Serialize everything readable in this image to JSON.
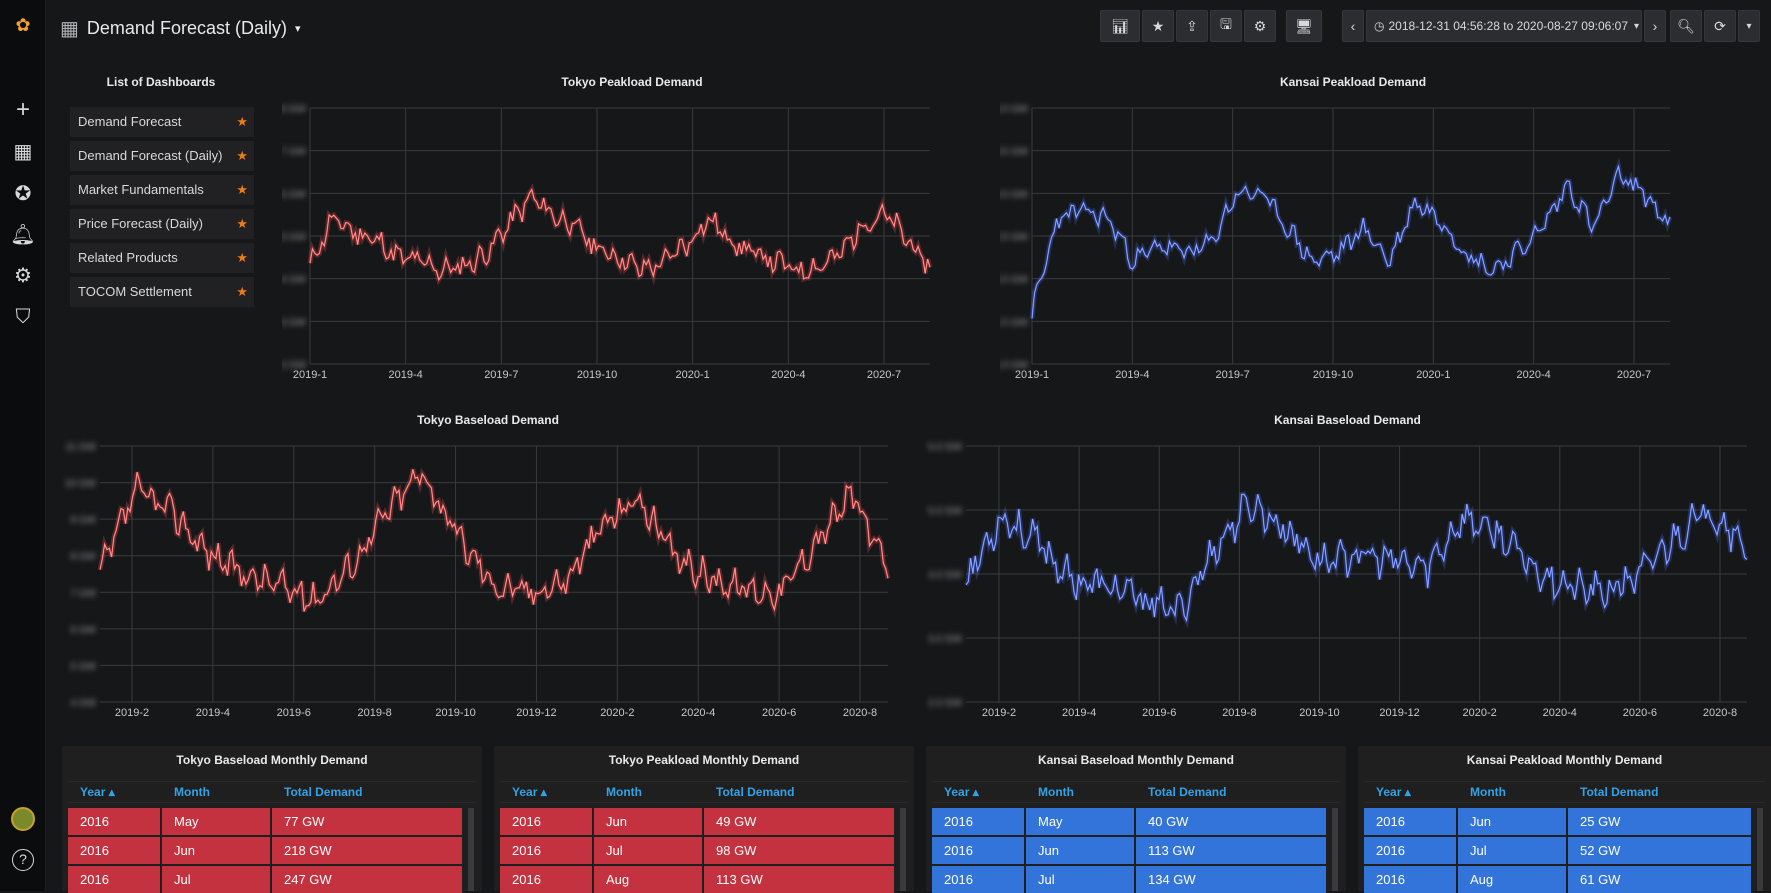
{
  "topbar": {
    "title": "Demand Forecast (Daily)",
    "time_range": "2018-12-31 04:56:28 to 2020-08-27 09:06:07"
  },
  "icons": {
    "logo": "grafana-logo",
    "add": "plus-icon",
    "dashboards": "grid-icon",
    "explore": "compass-icon",
    "alerting": "bell-icon",
    "config": "gear-icon",
    "admin": "shield-icon",
    "help": "help-icon"
  },
  "dashlist": {
    "title": "List of Dashboards",
    "items": [
      {
        "label": "Demand Forecast"
      },
      {
        "label": "Demand Forecast (Daily)"
      },
      {
        "label": "Market Fundamentals"
      },
      {
        "label": "Price Forecast (Daily)"
      },
      {
        "label": "Related Products"
      },
      {
        "label": "TOCOM Settlement"
      }
    ]
  },
  "colors": {
    "red": "#e02f44",
    "red_cell": "#c4313f",
    "blue": "#5577ff",
    "blue_cell": "#3274d9",
    "bg": "#161719"
  },
  "chart_data": [
    {
      "type": "line",
      "title": "Tokyo Peakload Demand",
      "color": "#ff5a5a",
      "x": [
        "2019-1",
        "2019-4",
        "2019-7",
        "2019-10",
        "2020-1",
        "2020-4",
        "2020-7"
      ],
      "yticks": [
        "8 GW",
        "7 GW",
        "6 GW",
        "5 GW",
        "4 GW",
        "3 GW",
        "2 GW"
      ],
      "series": [
        {
          "values": [
            4.3,
            5.4,
            5.1,
            4.9,
            4.5,
            4.4,
            4.2,
            4.3,
            4.6,
            5.3,
            5.9,
            5.5,
            5.2,
            4.7,
            4.5,
            4.2,
            4.4,
            4.8,
            5.4,
            4.9,
            4.6,
            4.4,
            4.2,
            4.3,
            4.6,
            5.3,
            5.5,
            4.9,
            4.2
          ]
        }
      ]
    },
    {
      "type": "line",
      "title": "Kansai Peakload Demand",
      "color": "#5577ff",
      "x": [
        "2019-1",
        "2019-4",
        "2019-7",
        "2019-10",
        "2020-1",
        "2020-4",
        "2020-7"
      ],
      "yticks": [
        "4.0 GW",
        "3.5 GW",
        "3.0 GW",
        "2.5 GW",
        "2.0 GW",
        "1.5 GW",
        "1.0 GW"
      ],
      "series": [
        {
          "values": [
            1.6,
            2.7,
            2.8,
            2.7,
            2.2,
            2.4,
            2.3,
            2.4,
            3.0,
            3.0,
            2.6,
            2.2,
            2.3,
            2.6,
            2.2,
            2.9,
            2.7,
            2.3,
            2.1,
            2.3,
            2.6,
            3.1,
            2.6,
            3.2,
            3.0,
            2.6
          ]
        }
      ]
    },
    {
      "type": "line",
      "title": "Tokyo Baseload Demand",
      "color": "#ff5a5a",
      "x": [
        "2019-2",
        "2019-4",
        "2019-6",
        "2019-8",
        "2019-10",
        "2019-12",
        "2020-2",
        "2020-4",
        "2020-6",
        "2020-8"
      ],
      "yticks": [
        "11 GW",
        "10 GW",
        "9 GW",
        "8 GW",
        "7 GW",
        "6 GW",
        "5 GW",
        "4 GW"
      ],
      "series": [
        {
          "values": [
            7.5,
            9.8,
            9.2,
            8.1,
            7.5,
            7.2,
            6.8,
            7.7,
            9.2,
            10.3,
            8.5,
            7.2,
            7.0,
            7.3,
            8.8,
            9.6,
            8.0,
            7.4,
            7.1,
            7.0,
            8.4,
            9.7,
            7.5
          ]
        }
      ]
    },
    {
      "type": "line",
      "title": "Kansai Baseload Demand",
      "color": "#5577ff",
      "x": [
        "2019-2",
        "2019-4",
        "2019-6",
        "2019-8",
        "2019-10",
        "2019-12",
        "2020-2",
        "2020-4",
        "2020-6",
        "2020-8"
      ],
      "yticks": [
        "6.0 GW",
        "5.0 GW",
        "4.0 GW",
        "3.0 GW",
        "2.0 GW"
      ],
      "series": [
        {
          "values": [
            3.9,
            4.9,
            4.5,
            3.9,
            3.8,
            3.6,
            3.4,
            4.4,
            5.1,
            4.7,
            4.2,
            4.3,
            4.2,
            4.1,
            4.9,
            4.6,
            4.1,
            3.8,
            3.7,
            4.0,
            4.6,
            5.0,
            4.4
          ]
        }
      ]
    }
  ],
  "tables": [
    {
      "title": "Tokyo Baseload Monthly Demand",
      "headers": [
        "Year",
        "Month",
        "Total Demand"
      ],
      "rows": [
        [
          "2016",
          "May",
          "77 GW"
        ],
        [
          "2016",
          "Jun",
          "218 GW"
        ],
        [
          "2016",
          "Jul",
          "247 GW"
        ]
      ]
    },
    {
      "title": "Tokyo Peakload Monthly Demand",
      "headers": [
        "Year",
        "Month",
        "Total Demand"
      ],
      "rows": [
        [
          "2016",
          "Jun",
          "49 GW"
        ],
        [
          "2016",
          "Jul",
          "98 GW"
        ],
        [
          "2016",
          "Aug",
          "113 GW"
        ]
      ]
    },
    {
      "title": "Kansai Baseload Monthly Demand",
      "headers": [
        "Year",
        "Month",
        "Total Demand"
      ],
      "rows": [
        [
          "2016",
          "May",
          "40 GW"
        ],
        [
          "2016",
          "Jun",
          "113 GW"
        ],
        [
          "2016",
          "Jul",
          "134 GW"
        ]
      ]
    },
    {
      "title": "Kansai Peakload Monthly Demand",
      "headers": [
        "Year",
        "Month",
        "Total Demand"
      ],
      "rows": [
        [
          "2016",
          "Jun",
          "25 GW"
        ],
        [
          "2016",
          "Jul",
          "52 GW"
        ],
        [
          "2016",
          "Aug",
          "61 GW"
        ]
      ]
    }
  ]
}
